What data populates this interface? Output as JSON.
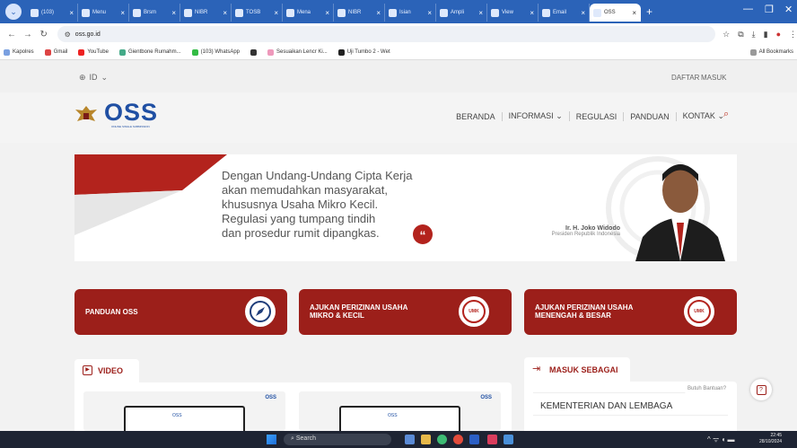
{
  "browser": {
    "tabs": [
      {
        "label": "(103)"
      },
      {
        "label": "Menu"
      },
      {
        "label": "Brsm"
      },
      {
        "label": "NIBR"
      },
      {
        "label": "TOSB"
      },
      {
        "label": "Mena"
      },
      {
        "label": "NIBR"
      },
      {
        "label": "Isian"
      },
      {
        "label": "Ampli"
      },
      {
        "label": "View"
      },
      {
        "label": "Email"
      },
      {
        "label": "OSS"
      }
    ],
    "url": "oss.go.id",
    "bookmarks": [
      "Kapolres",
      "Gmail",
      "YouTube",
      "Gientbone Rumahm...",
      "(103) WhatsApp",
      "Sesuaikan Lencr Ki...",
      "Uji Tumbo 2 - Wet"
    ],
    "all_bookmarks": "All Bookmarks",
    "new_tab": "+"
  },
  "page": {
    "lang": "ID",
    "daftar": "DAFTAR",
    "masuk": "MASUK",
    "logo_text": "OSS",
    "logo_sub": "ONLINE SINGLE SUBMISSION",
    "nav": [
      "BERANDA",
      "INFORMASI",
      "REGULASI",
      "PANDUAN",
      "KONTAK"
    ],
    "hero_lines": [
      "Dengan Undang-Undang Cipta Kerja",
      "akan memudahkan masyarakat,",
      "khususnya Usaha Mikro Kecil.",
      "Regulasi yang tumpang tindih",
      "dan prosedur rumit dipangkas."
    ],
    "hero_name": "Ir. H. Joko Widodo",
    "hero_role": "Presiden Republik Indonesia",
    "cta": [
      {
        "line1": "PANDUAN OSS",
        "line2": ""
      },
      {
        "line1": "AJUKAN PERIZINAN USAHA",
        "line2": "MIKRO & KECIL"
      },
      {
        "line1": "AJUKAN PERIZINAN USAHA",
        "line2": "MENENGAH & BESAR"
      }
    ],
    "badge_umk": "UMK",
    "badge_non_umk": "UMK",
    "video_title": "VIDEO",
    "masuk_sebagai": "MASUK SEBAGAI",
    "kementerian": "KEMENTERIAN DAN LEMBAGA",
    "help": "Butuh Bantuan?",
    "video_logo": "OSS"
  },
  "taskbar": {
    "search": "Search",
    "time": "22:45",
    "date": "28/10/2024"
  },
  "colors": {
    "accent_red": "#9c1f1a",
    "browser_blue": "#2b63b8",
    "oss_blue": "#1f4fa3"
  }
}
